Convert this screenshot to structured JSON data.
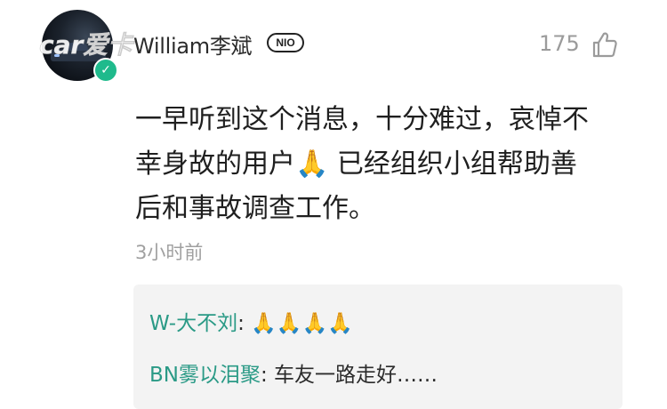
{
  "watermark": {
    "text": "Xcar爱卡"
  },
  "comment": {
    "username": "William李斌",
    "brand_badge": "NIO",
    "like_count": "175",
    "text_line1": "一早听到这个消息，十分难过，哀悼不",
    "text_line2a": "幸身故的用户",
    "text_line2b": "已经组织小组帮助善",
    "text_line3": "后和事故调查工作。",
    "pray_emoji": "🙏",
    "time": "3小时前"
  },
  "replies": [
    {
      "author": "W-大不刘",
      "separator": ": ",
      "text": "🙏🙏🙏🙏"
    },
    {
      "author": "BN雾以泪聚",
      "separator": ": ",
      "text": "车友一路走好……"
    }
  ],
  "colors": {
    "verified": "#1fba8c",
    "reply_author": "#2a9a86",
    "muted": "#9b9b9b"
  }
}
